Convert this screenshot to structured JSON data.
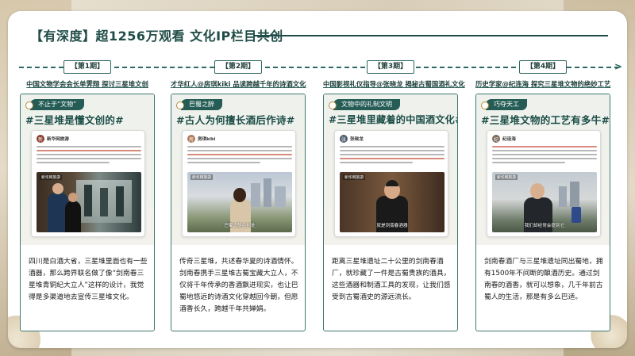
{
  "title": "【有深度】超1256万观看  文化IP栏目共创",
  "phases": [
    {
      "label": "【第1期】",
      "subtitle": "中国文物学会会长单霁翔  探讨三星堆文创",
      "tag": "不止于“文物”",
      "hashtag": "#三星堆是懂文创的#",
      "post_name": "新华网旅游",
      "avatar_letter": "新",
      "media_brand": "新华网旅游",
      "media_caption": "",
      "description": "四川是白酒大省，三星堆里面也有一些酒器，那么跨界联名做了像“剑南春三星堆青铜纪大立人”这样的设计，我觉得是多渠道地去宣传三星堆文化。"
    },
    {
      "label": "【第2期】",
      "subtitle": "才华红人@房琪kiki  品读跨越千年的诗酒文化",
      "tag": "巴蜀之醉",
      "hashtag": "#古人为何擅长酒后作诗#",
      "post_name": "房琪kiki",
      "avatar_letter": "房",
      "media_brand": "新华网旅游",
      "media_caption": "巴蜀之醉在何处",
      "description": "传奇三星堆，共述春华夏的诗酒情怀。剑南春携手三星堆古蜀宝藏大立人，不仅将千年传承的香酒飘进现实，也让巴蜀地悠远的诗酒文化穿越回今朝，但愿酒香长久，跨越千年共婵娟。"
    },
    {
      "label": "【第3期】",
      "subtitle": "中国影视礼仪指导@张晓龙  揭秘古蜀国酒礼文化",
      "tag": "文物中的礼制文明",
      "hashtag": "#三星堆里藏着的中国酒文化#",
      "post_name": "张晓龙",
      "avatar_letter": "张",
      "media_brand": "新华网旅游",
      "media_caption": "就是剑南春酒器",
      "description": "距离三星堆遗址二十公里的剑南春酒厂，就珍藏了一件是古蜀贵族的酒具，这些酒器和制酒工具的发现，让我们感受到古蜀酒史的源远流长。"
    },
    {
      "label": "【第4期】",
      "subtitle": "历史学家@纪连海  探究三星堆文物的绝妙工艺",
      "tag": "巧夺天工",
      "hashtag": "#三星堆文物的工艺有多牛#",
      "post_name": "纪连海",
      "avatar_letter": "纪",
      "media_brand": "新华网旅游",
      "media_caption": "我们却经常会提到它",
      "description": "剑南春酒厂与三星堆遗址同出蜀地，拥有1500年不间断的酿酒历史。通过剑南春的酒香，就可以想象，几千年前古蜀人的生活，那是有多么巴适。"
    }
  ],
  "colors": {
    "primary": "#1f4c46",
    "accent_tag": "#255c55",
    "gold": "#b98b3b"
  }
}
